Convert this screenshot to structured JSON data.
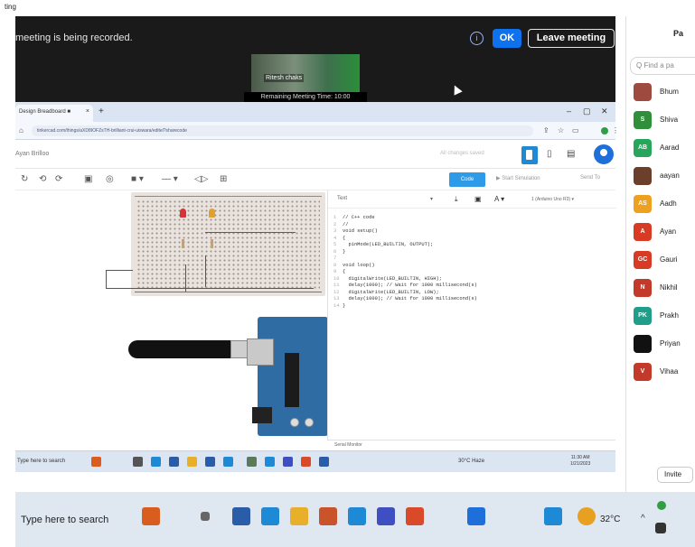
{
  "zoom": {
    "app_label": "ting",
    "recording_message": "meeting is being recorded.",
    "ok_label": "OK",
    "leave_label": "Leave meeting",
    "video_name": "Ritesh chaks",
    "remaining_time": "Remaining Meeting Time: 10:00",
    "colors": {
      "ok": "#0e72ed",
      "banner_bg": "#1a1a1a"
    }
  },
  "browser": {
    "tab_title": "Design Breadboard ■ ",
    "tab_close": "×",
    "new_tab": "+",
    "url": "tinkercad.com/things/aXD8IOFZsTH-brilliant-crui-uiswara/editel?sharecode",
    "window_controls": [
      "–",
      "▢",
      "✕"
    ]
  },
  "tinkercad": {
    "project_name": "Ayan Brilloo",
    "saved_status": "All changes saved",
    "code_label": "Code",
    "simulation_label": "Start Simulation",
    "send_label": "Send To"
  },
  "editor": {
    "mode": "Text",
    "board_selector": "1 (Arduino Uno R3) ▾",
    "code_lines": [
      {
        "n": "1",
        "t": "// C++ code"
      },
      {
        "n": "2",
        "t": "//"
      },
      {
        "n": "3",
        "t": "void setup()"
      },
      {
        "n": "4",
        "t": "{"
      },
      {
        "n": "5",
        "t": "  pinMode(LED_BUILTIN, OUTPUT);"
      },
      {
        "n": "6",
        "t": "}"
      },
      {
        "n": "7",
        "t": ""
      },
      {
        "n": "8",
        "t": "void loop()"
      },
      {
        "n": "9",
        "t": "{"
      },
      {
        "n": "10",
        "t": "  digitalWrite(LED_BUILTIN, HIGH);"
      },
      {
        "n": "11",
        "t": "  delay(1000); // Wait for 1000 millisecond(s)"
      },
      {
        "n": "12",
        "t": "  digitalWrite(LED_BUILTIN, LOW);"
      },
      {
        "n": "13",
        "t": "  delay(1000); // Wait for 1000 millisecond(s)"
      },
      {
        "n": "14",
        "t": "}"
      }
    ],
    "serial_monitor": "Serial Monitor"
  },
  "inner_taskbar": {
    "search": "Type here to search",
    "weather": "30°C Haze",
    "time": "11:30 AM",
    "date": "1/21/2023"
  },
  "participants": {
    "title": "Pa",
    "find_placeholder": "Q Find a pa",
    "list": [
      {
        "initials": "",
        "name": "Bhum",
        "color": "#9e4a3f"
      },
      {
        "initials": "S",
        "name": "Shiva",
        "color": "#2f8f3a"
      },
      {
        "initials": "AB",
        "name": "Aarad",
        "color": "#26a65b"
      },
      {
        "initials": "",
        "name": "aayan",
        "color": "#6b3f2a"
      },
      {
        "initials": "AS",
        "name": "Aadh",
        "color": "#f0a020"
      },
      {
        "initials": "A",
        "name": "Ayan",
        "color": "#d83b24"
      },
      {
        "initials": "GC",
        "name": "Gauri",
        "color": "#d83b24"
      },
      {
        "initials": "N",
        "name": "Nikhil",
        "color": "#c33a2a"
      },
      {
        "initials": "PK",
        "name": "Prakh",
        "color": "#1f9e8a"
      },
      {
        "initials": "",
        "name": "Priyan",
        "color": "#111111"
      },
      {
        "initials": "V",
        "name": "Vihaa",
        "color": "#c33a2a"
      }
    ],
    "invite": "Invite"
  },
  "outer_taskbar": {
    "search": "Type here to search",
    "weather": "32°C"
  }
}
